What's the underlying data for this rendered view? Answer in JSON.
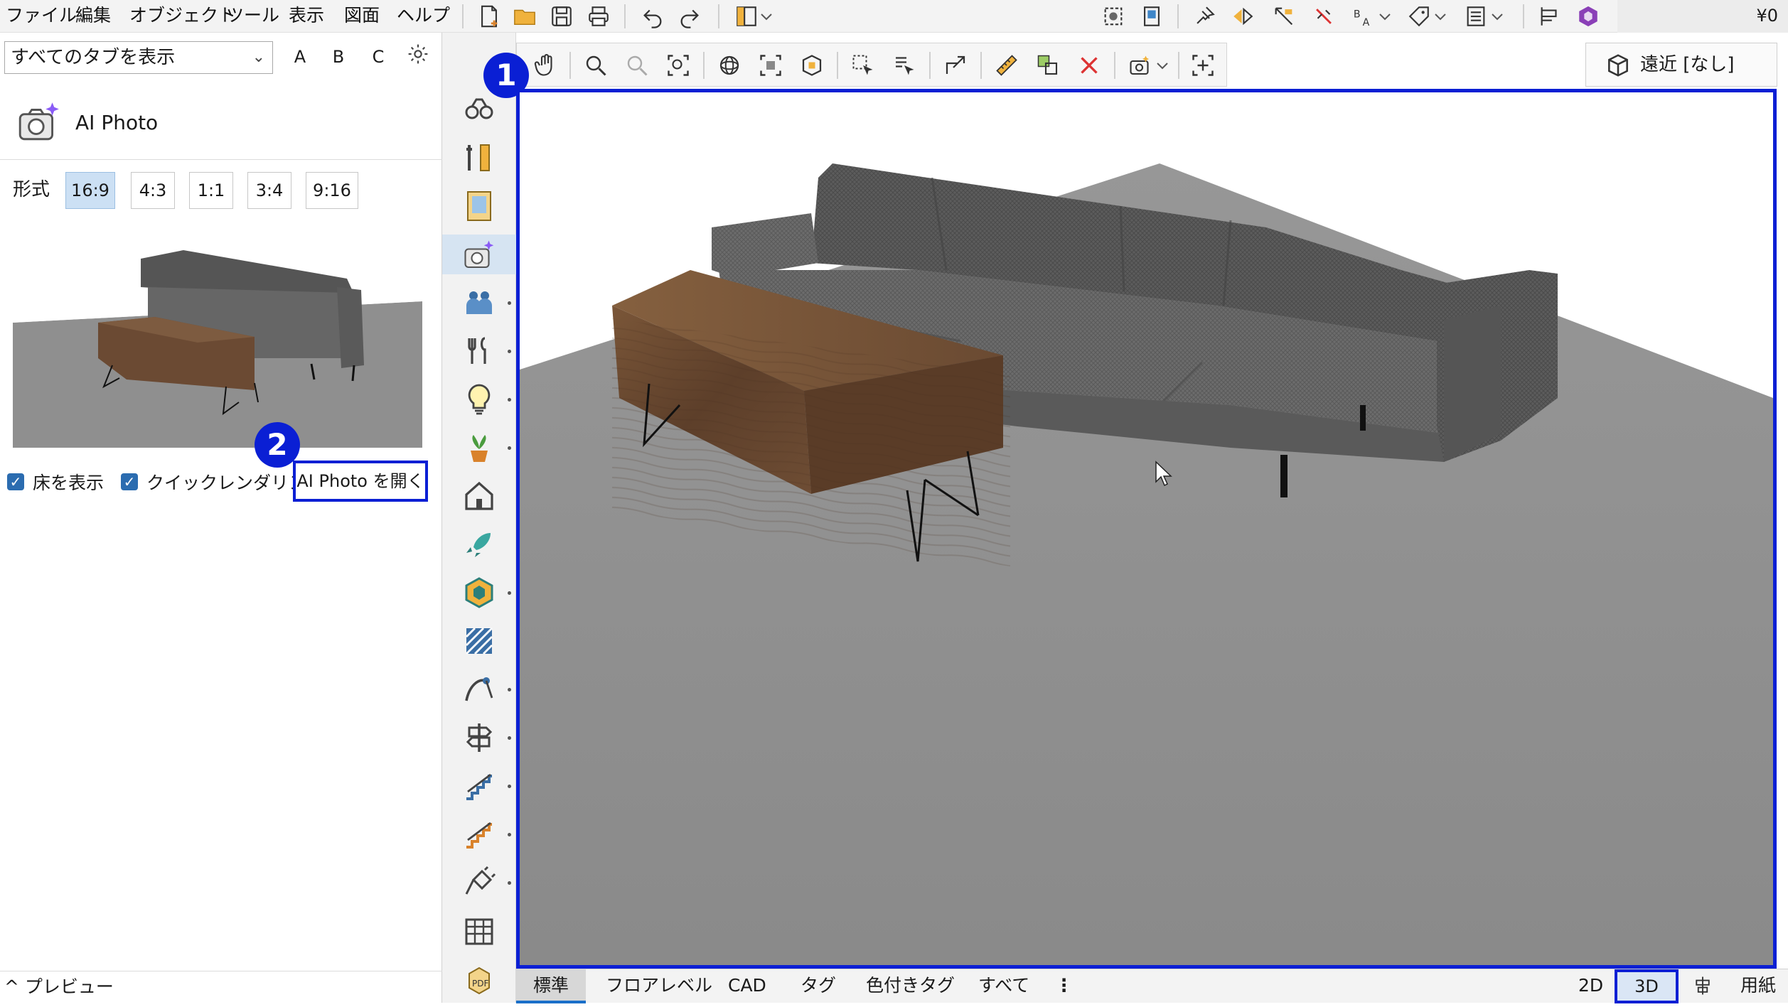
{
  "menu": {
    "items": [
      "ファイル",
      "編集",
      "オブジェクト",
      "ツール",
      "表示",
      "図面",
      "ヘルプ"
    ],
    "price": "¥0"
  },
  "left_panel": {
    "tag_select": {
      "value": "すべてのタブを表示"
    },
    "letters": [
      "A",
      "B",
      "C"
    ],
    "title": "AI Photo",
    "format_label": "形式",
    "formats": [
      "16:9",
      "4:3",
      "1:1",
      "3:4",
      "9:16"
    ],
    "active_format": "16:9",
    "show_floor_label": "床を表示",
    "quick_render_label": "クイックレンダリング",
    "open_button": "AI Photo を開く",
    "preview_footer": "プレビュー"
  },
  "viewport": {
    "perspective_label": "遠近 [なし]"
  },
  "badges": [
    "1",
    "2"
  ],
  "bottom_bar": {
    "tabs": [
      "標準",
      "フロアレベル",
      "CAD",
      "タグ",
      "色付きタグ",
      "すべて"
    ],
    "active_tab": "標準",
    "more": "⋮",
    "view_2d": "2D",
    "view_3d": "3D",
    "paper": "用紙"
  },
  "colors": {
    "highlight": "#0a1fd4",
    "active_format_bg": "#cce0f4",
    "checkbox": "#2b6cb0",
    "floor": "#8f8f8f",
    "sofa": "#6e6e6e",
    "table_wood": "#6b4a33"
  }
}
